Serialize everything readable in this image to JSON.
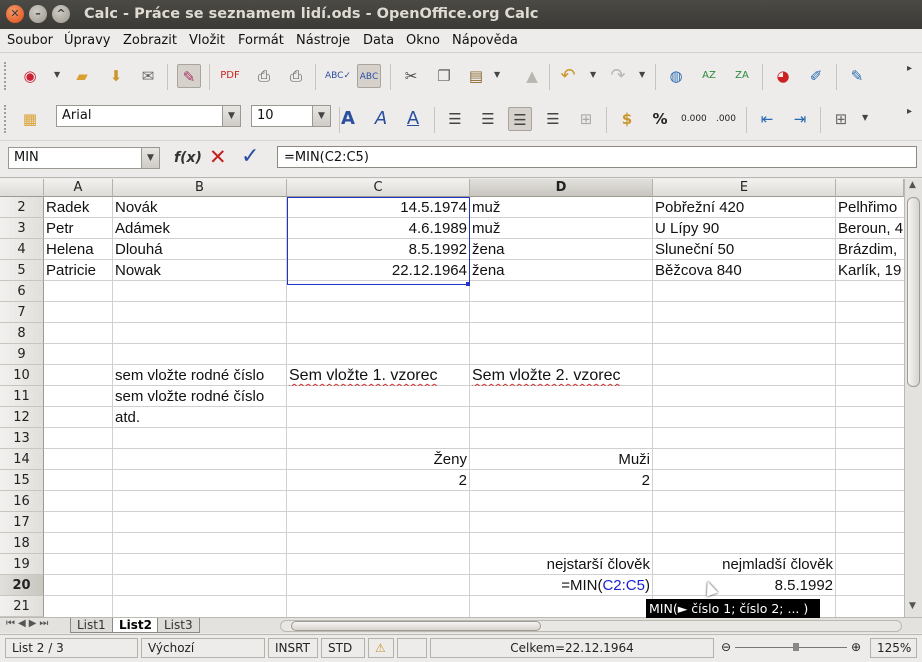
{
  "window": {
    "title": "Calc - Práce se seznamem lidí.ods - OpenOffice.org Calc"
  },
  "menu": [
    "Soubor",
    "Úpravy",
    "Zobrazit",
    "Vložit",
    "Formát",
    "Nástroje",
    "Data",
    "Okno",
    "Nápověda"
  ],
  "formatting": {
    "font_name": "Arial",
    "font_size": "10"
  },
  "formula_bar": {
    "name_box": "MIN",
    "fx_label": "f(x)",
    "formula": "=MIN(C2:C5)"
  },
  "columns": [
    "A",
    "B",
    "C",
    "D",
    "E"
  ],
  "rows": [
    "2",
    "3",
    "4",
    "5",
    "6",
    "7",
    "8",
    "9",
    "10",
    "11",
    "12",
    "13",
    "14",
    "15",
    "16",
    "17",
    "18",
    "19",
    "20",
    "21"
  ],
  "cells": {
    "A2": "Radek",
    "B2": "Novák",
    "C2": "14.5.1974",
    "D2": "muž",
    "E2": "Pobřežní 420",
    "F2": "Pelhřimo",
    "A3": "Petr",
    "B3": "Adámek",
    "C3": "4.6.1989",
    "D3": "muž",
    "E3": "U Lípy 90",
    "F3": "Beroun, 4",
    "A4": "Helena",
    "B4": "Dlouhá",
    "C4": "8.5.1992",
    "D4": "žena",
    "E4": "Sluneční 50",
    "F4": "Brázdim,",
    "A5": "Patricie",
    "B5": "Nowak",
    "C5": "22.12.1964",
    "D5": "žena",
    "E5": "Běžcova 840",
    "F5": "Karlík, 19",
    "B10": "sem vložte rodné číslo",
    "C10": "Sem vložte 1. vzorec",
    "D10": "Sem vložte 2. vzorec",
    "B11": "sem vložte rodné číslo",
    "B12": "atd.",
    "C14": "Ženy",
    "D14": "Muži",
    "C15": "2",
    "D15": "2",
    "D19": "nejstarší člověk",
    "E19": "nejmladší člověk",
    "D20_prefix": "=MIN(",
    "D20_ref": "C2:C5",
    "D20_suffix": ")",
    "E20": "8.5.1992"
  },
  "tooltip": "MIN(► číslo 1; číslo 2; ... )",
  "sheets": [
    "List1",
    "List2",
    "List3"
  ],
  "active_sheet": "List2",
  "status": {
    "sheet": "List 2 / 3",
    "style": "Výchozí",
    "insert": "INSRT",
    "selection_mode": "STD",
    "sum": "Celkem=22.12.1964",
    "zoom": "125%"
  },
  "colors": {
    "selection": "#2233cc",
    "reference": "#1a22d0",
    "spell": "#d23030"
  }
}
